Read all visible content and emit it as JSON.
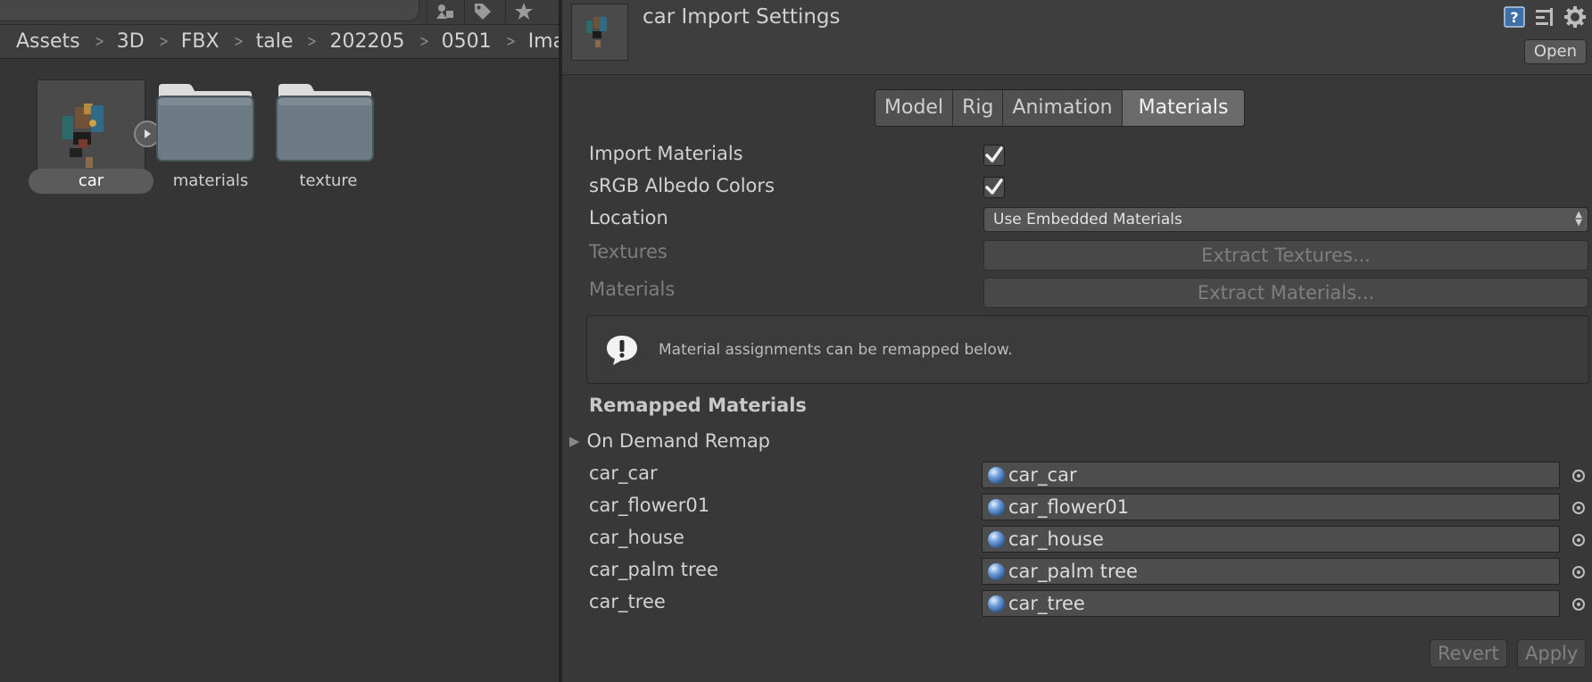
{
  "project": {
    "breadcrumb": [
      "Assets",
      "3D",
      "FBX",
      "tale",
      "202205",
      "0501",
      "Imag"
    ],
    "toolbar_icons": [
      "filter-by-type-icon",
      "filter-by-label-icon",
      "favorites-star-icon"
    ],
    "assets": [
      {
        "name": "car",
        "kind": "model",
        "selected": true
      },
      {
        "name": "materials",
        "kind": "folder",
        "selected": false
      },
      {
        "name": "texture",
        "kind": "folder",
        "selected": false
      }
    ]
  },
  "inspector": {
    "title": "car Import Settings",
    "open_label": "Open",
    "header_icons": [
      "help-icon",
      "presets-icon",
      "settings-gear-icon"
    ],
    "tabs": [
      {
        "label": "Model",
        "active": false
      },
      {
        "label": "Rig",
        "active": false
      },
      {
        "label": "Animation",
        "active": false
      },
      {
        "label": "Materials",
        "active": true
      }
    ],
    "import_materials": {
      "label": "Import Materials",
      "checked": true
    },
    "srgb_albedo": {
      "label": "sRGB Albedo Colors",
      "checked": true
    },
    "location": {
      "label": "Location",
      "value": "Use Embedded Materials"
    },
    "textures": {
      "label": "Textures",
      "button": "Extract Textures..."
    },
    "materials": {
      "label": "Materials",
      "button": "Extract Materials..."
    },
    "info_message": "Material assignments can be remapped below.",
    "remapped_title": "Remapped Materials",
    "on_demand_remap": "On Demand Remap",
    "remaps": [
      {
        "label": "car_car",
        "value": "car_car"
      },
      {
        "label": "car_flower01",
        "value": "car_flower01"
      },
      {
        "label": "car_house",
        "value": "car_house"
      },
      {
        "label": "car_palm tree",
        "value": "car_palm tree"
      },
      {
        "label": "car_tree",
        "value": "car_tree"
      }
    ],
    "revert_label": "Revert",
    "apply_label": "Apply"
  }
}
